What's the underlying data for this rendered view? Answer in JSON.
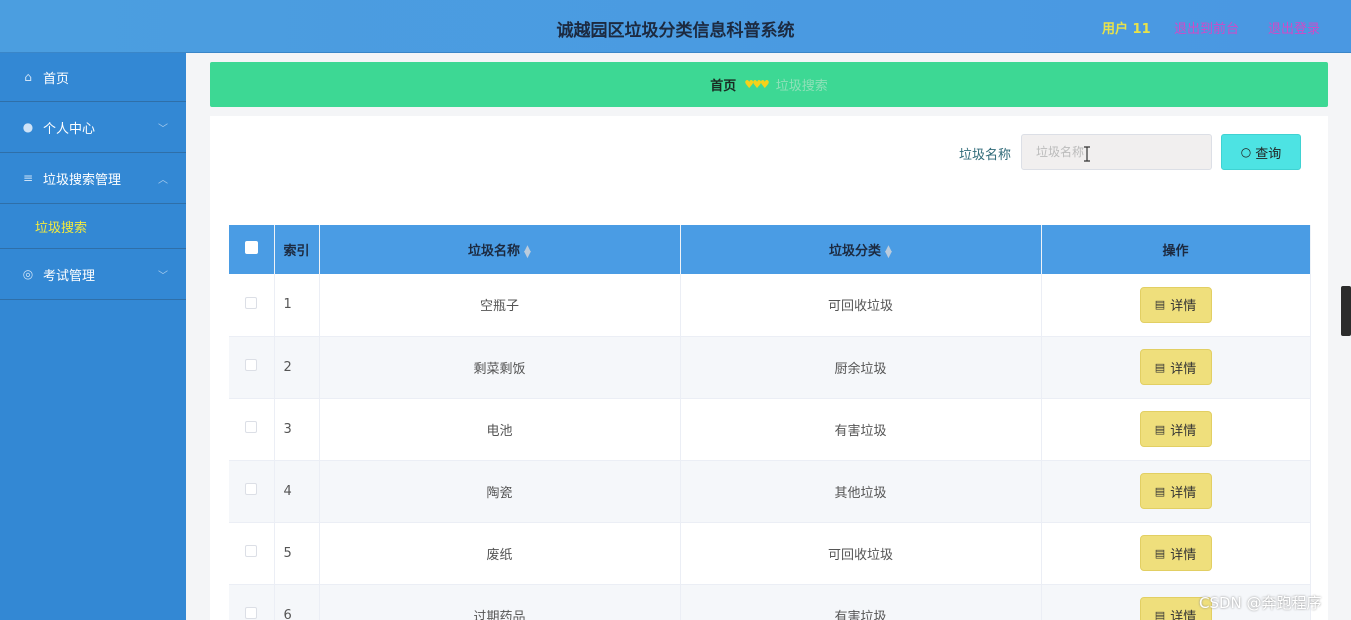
{
  "header": {
    "title": "诚越园区垃圾分类信息科普系统",
    "user": "用户 11",
    "to_front": "退出到前台",
    "logout": "退出登录",
    "colors": {
      "bar": "#4a9ce2",
      "user": "#e8e24a",
      "links": "#d04ac8"
    }
  },
  "sidebar": {
    "items": [
      {
        "label": "首页",
        "icon": "home-icon"
      },
      {
        "label": "个人中心",
        "icon": "user-icon"
      },
      {
        "label": "垃圾搜索管理",
        "icon": "menu-icon",
        "expanded": true
      },
      {
        "label": "垃圾搜索",
        "sub": true,
        "active": true
      },
      {
        "label": "考试管理",
        "icon": "exam-icon"
      }
    ]
  },
  "breadcrumb": {
    "home": "首页",
    "separator": "♥♥♥",
    "current": "垃圾搜索"
  },
  "search": {
    "label": "垃圾名称",
    "placeholder": "垃圾名称",
    "button": "查询"
  },
  "table": {
    "headers": [
      "索引",
      "垃圾名称",
      "垃圾分类",
      "操作"
    ],
    "rows": [
      {
        "index": "1",
        "name": "空瓶子",
        "category": "可回收垃圾",
        "action": "详情"
      },
      {
        "index": "2",
        "name": "剩菜剩饭",
        "category": "厨余垃圾",
        "action": "详情"
      },
      {
        "index": "3",
        "name": "电池",
        "category": "有害垃圾",
        "action": "详情"
      },
      {
        "index": "4",
        "name": "陶瓷",
        "category": "其他垃圾",
        "action": "详情"
      },
      {
        "index": "5",
        "name": "废纸",
        "category": "可回收垃圾",
        "action": "详情"
      },
      {
        "index": "6",
        "name": "过期药品",
        "category": "有害垃圾",
        "action": "详情"
      }
    ]
  },
  "watermark": "CSDN @奔跑程序"
}
